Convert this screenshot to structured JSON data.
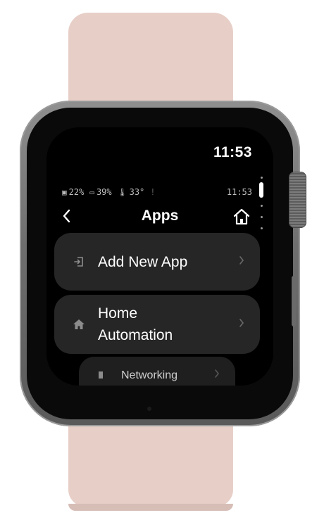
{
  "statusbar": {
    "time": "11:53"
  },
  "system_info": {
    "cpu": "22%",
    "battery": "39%",
    "temperature": "33°",
    "signal": "!",
    "time": "11:53"
  },
  "nav": {
    "back_glyph": "<",
    "title": "Apps"
  },
  "menu": {
    "items": [
      {
        "label": "Add New App",
        "icon": "login-arrow-icon"
      },
      {
        "label": "Home\nAutomation",
        "icon": "house-icon"
      },
      {
        "label": "Networking",
        "icon": "network-icon"
      }
    ]
  },
  "colors": {
    "screen_bg": "#000000",
    "row_bg": "#262626",
    "band": "#e7cfc8"
  }
}
